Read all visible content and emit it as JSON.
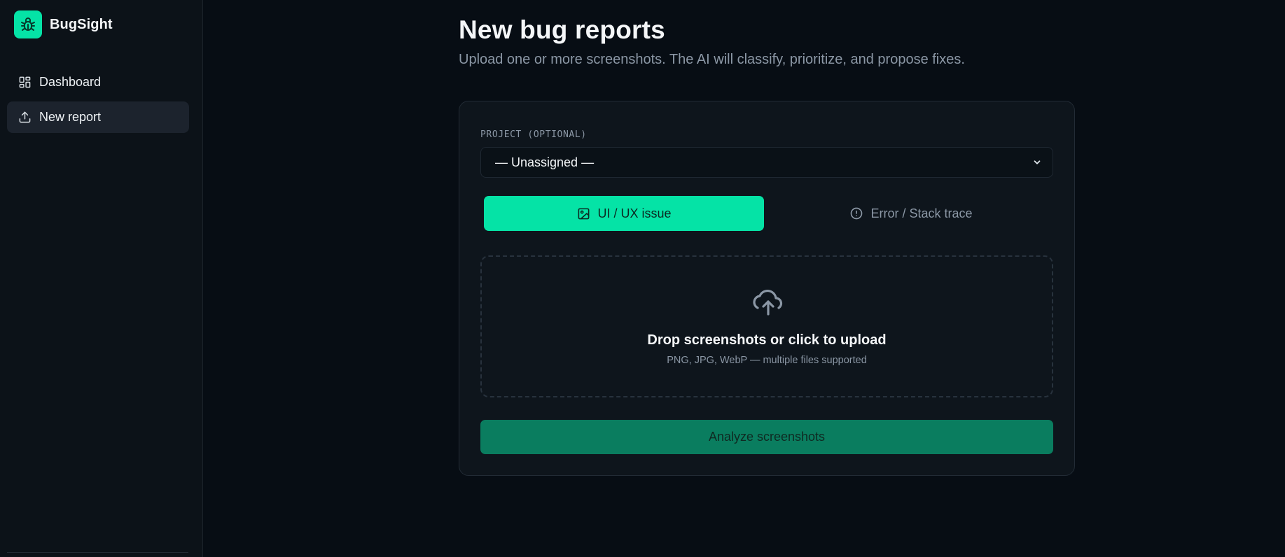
{
  "app": {
    "name": "BugSight",
    "logo_icon": "bug-icon",
    "accent": "#05e3a6"
  },
  "sidebar": {
    "items": [
      {
        "label": "Dashboard",
        "icon": "dashboard-grid-icon",
        "active": false
      },
      {
        "label": "New report",
        "icon": "upload-icon",
        "active": true
      }
    ]
  },
  "page": {
    "title": "New bug reports",
    "subtitle": "Upload one or more screenshots. The AI will classify, prioritize, and propose fixes."
  },
  "form": {
    "project_label": "PROJECT (OPTIONAL)",
    "project_value": "— Unassigned —",
    "type_tabs": [
      {
        "label": "UI / UX issue",
        "icon": "image-icon",
        "selected": true
      },
      {
        "label": "Error / Stack trace",
        "icon": "alert-circle-icon",
        "selected": false
      }
    ],
    "dropzone": {
      "icon": "cloud-upload-icon",
      "title": "Drop screenshots or click to upload",
      "hint": "PNG, JPG, WebP — multiple files supported"
    },
    "submit_label": "Analyze screenshots"
  }
}
